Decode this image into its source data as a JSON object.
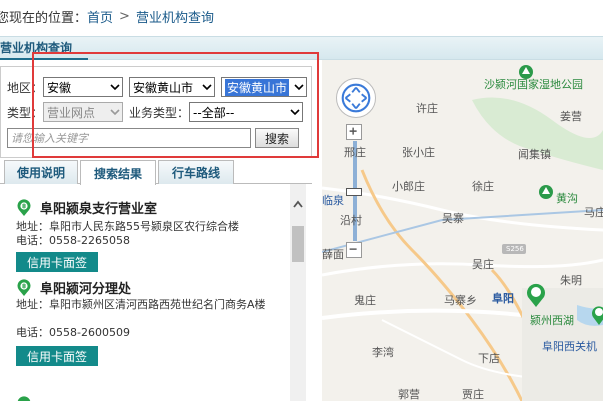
{
  "breadcrumb": {
    "prefix": "您现在的位置：",
    "home": "首页",
    "separator": ">",
    "current": "营业机构查询"
  },
  "section": {
    "title": "营业机构查询"
  },
  "search": {
    "region_label": "地区：",
    "province_value": "安徽",
    "city_value": "安徽黄山市",
    "district_value": "安徽黄山市",
    "type_label": "类型：",
    "type_value": "营业网点",
    "business_label": "业务类型：",
    "business_value": "--全部--",
    "keyword_placeholder": "请您输入关键字",
    "search_button": "搜索"
  },
  "tabs": [
    {
      "label": "使用说明"
    },
    {
      "label": "搜索结果"
    },
    {
      "label": "行车路线"
    }
  ],
  "results": [
    {
      "name": "阜阳颍泉支行营业室",
      "address": "地址：阜阳市人民东路55号颍泉区农行综合楼",
      "phone": "电话：0558-2265058",
      "button": "信用卡面签"
    },
    {
      "name": "阜阳颍河分理处",
      "address": "地址：阜阳市颍州区清河西路西苑世纪名门商务A楼",
      "phone": "电话：0558-2600509",
      "button": "信用卡面签"
    }
  ],
  "map": {
    "labels": [
      "沙颍河国家湿地公园",
      "许庄",
      "姜营",
      "张小庄",
      "闻集镇",
      "小郎庄",
      "徐庄",
      "黄沟",
      "马庄",
      "临泉",
      "沿村",
      "吴寨",
      "薛面",
      "吴庄",
      "朱明",
      "鬼庄",
      "马寨乡",
      "阜阳",
      "颍州西湖",
      "阜阳西关机",
      "李湾",
      "下店",
      "郭营",
      "贾庄",
      "S256",
      "邢庄"
    ]
  },
  "colors": {
    "accent": "#1e6d8c",
    "highlight_box": "#e03a3a",
    "card_button": "#138a8a"
  }
}
